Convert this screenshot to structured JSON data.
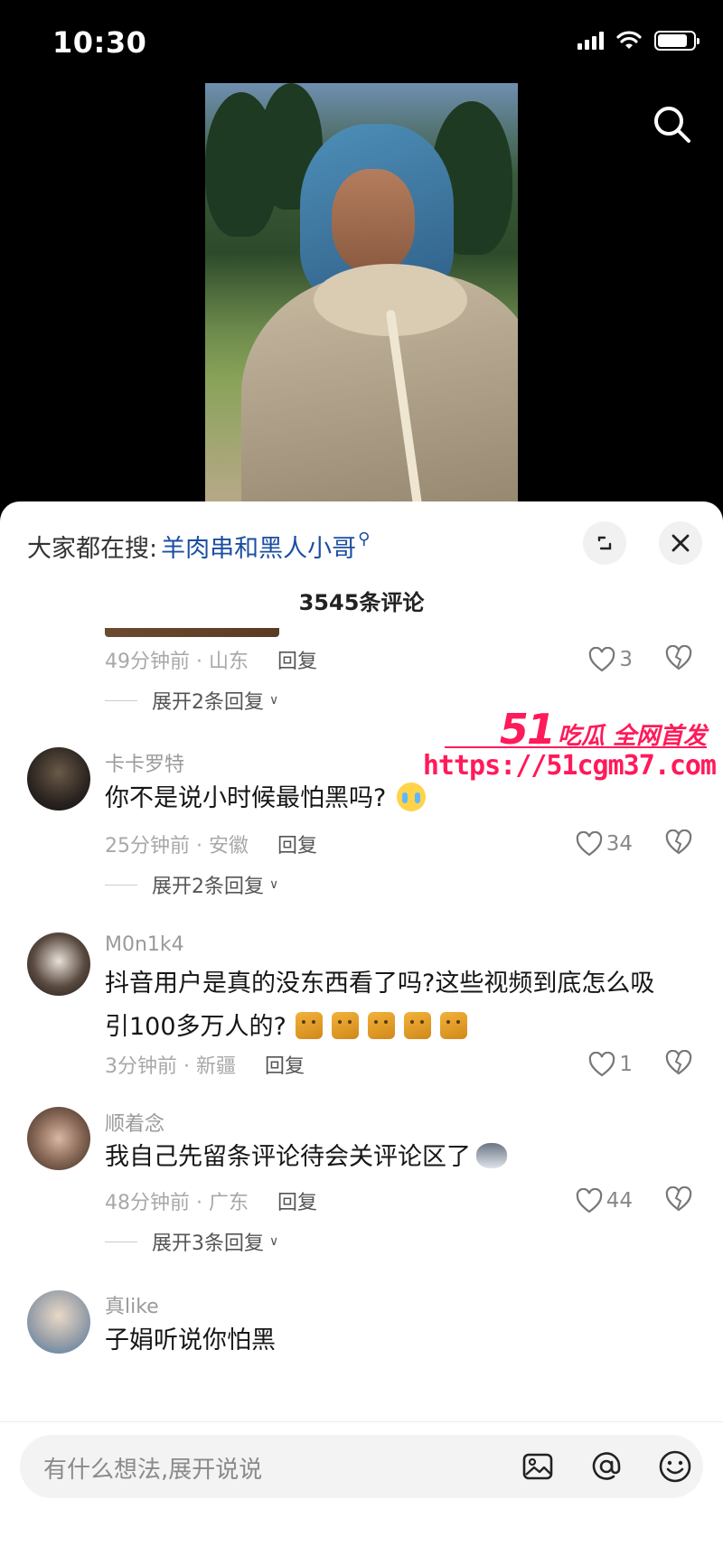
{
  "status_bar": {
    "time": "10:30",
    "battery_level": 0.85
  },
  "video": {
    "search_icon": "search-icon"
  },
  "sheet": {
    "trending_prefix": "大家都在搜:",
    "trending_query": "羊肉串和黑人小哥",
    "comment_count": "3545条评论",
    "expand_icon": "expand-icon",
    "close_icon": "close-icon"
  },
  "comments": [
    {
      "username": "",
      "text": "",
      "meta": "49分钟前 · 山东",
      "reply_label": "回复",
      "likes": "3",
      "replies_label": "展开2条回复"
    },
    {
      "username": "卡卡罗特",
      "text": "你不是说小时候最怕黑吗?",
      "emoji": "crying-face",
      "meta": "25分钟前 · 安徽",
      "reply_label": "回复",
      "likes": "34",
      "replies_label": "展开2条回复"
    },
    {
      "username": "M0n1k4",
      "text_line1": "抖音用户是真的没东西看了吗?这些视频到底怎么吸",
      "text_line2": "引100多万人的?",
      "emoji": "cat-emoji x5",
      "meta": "3分钟前 · 新疆",
      "reply_label": "回复",
      "likes": "1"
    },
    {
      "username": "顺着念",
      "text": "我自己先留条评论待会关评论区了",
      "emoji": "dog-emoji",
      "meta": "48分钟前 · 广东",
      "reply_label": "回复",
      "likes": "44",
      "replies_label": "展开3条回复"
    },
    {
      "username": "真like",
      "text": "子娟听说你怕黑"
    }
  ],
  "watermark": {
    "brand_number": "51",
    "brand_text": "吃瓜 全网首发",
    "url": "https://51cgm37.com"
  },
  "input_bar": {
    "placeholder": "有什么想法,展开说说",
    "icons": [
      "image-icon",
      "at-icon",
      "emoji-icon"
    ]
  },
  "colors": {
    "link_blue": "#1c4fa1",
    "watermark_pink": "#ff1a5a",
    "meta_gray": "#a8a8a8"
  }
}
